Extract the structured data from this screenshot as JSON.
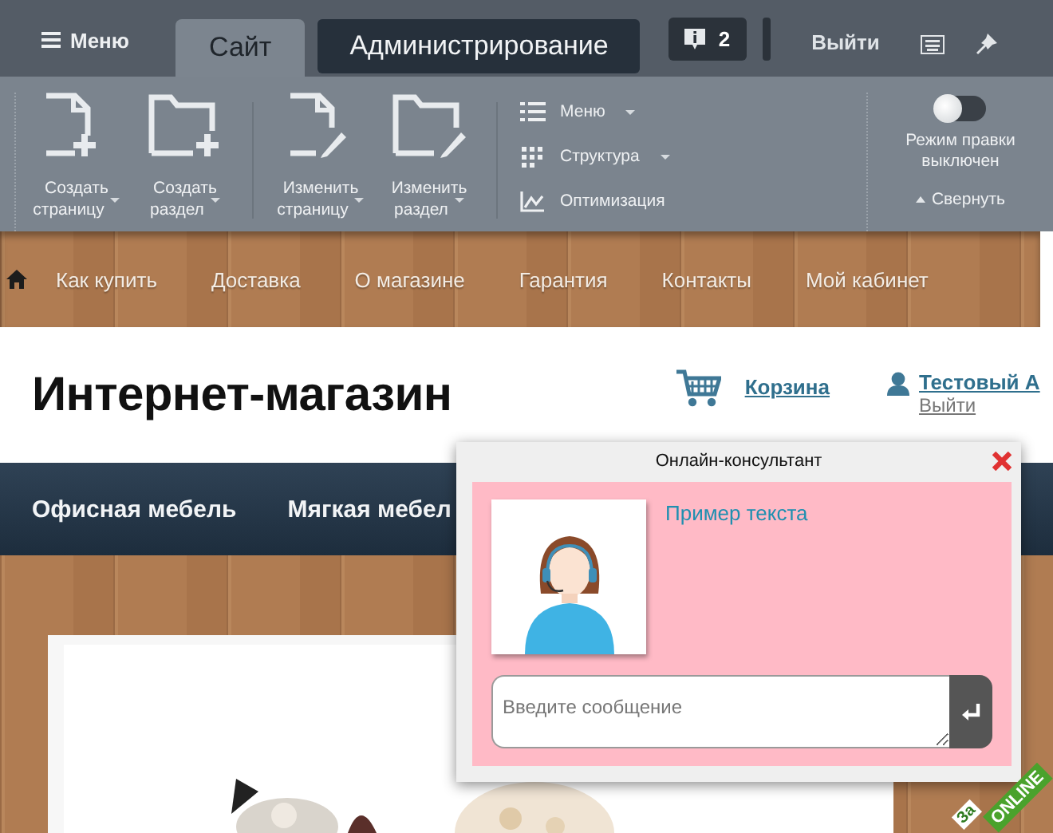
{
  "admin_bar": {
    "menu_button": "Меню",
    "tabs": [
      {
        "label": "Сайт",
        "selected": true
      },
      {
        "label": "Администрирование",
        "selected": false
      }
    ],
    "notifications": "2",
    "logout": "Выйти"
  },
  "toolbar": {
    "large_buttons": [
      {
        "kind": "page-add",
        "label": "Создать страницу",
        "dropdown": true
      },
      {
        "kind": "folder-add",
        "label": "Создать раздел",
        "dropdown": true
      },
      {
        "kind": "page-edit",
        "label": "Изменить страницу",
        "dropdown": true
      },
      {
        "kind": "folder-edit",
        "label": "Изменить раздел",
        "dropdown": true
      }
    ],
    "small_buttons": [
      {
        "kind": "list",
        "label": "Меню",
        "dropdown": true
      },
      {
        "kind": "grid",
        "label": "Структура",
        "dropdown": true
      },
      {
        "kind": "chart",
        "label": "Оптимизация",
        "dropdown": false
      }
    ],
    "edit_mode": {
      "label": "Режим правки выключен",
      "on": false
    },
    "collapse": "Свернуть"
  },
  "site_nav": [
    "Как купить",
    "Доставка",
    "О магазине",
    "Гарантия",
    "Контакты",
    "Мой кабинет"
  ],
  "site_header": {
    "title": "Интернет-магазин",
    "cart": "Корзина",
    "user": "Тестовый А",
    "logout": "Выйти"
  },
  "catalog_nav": [
    "Офисная мебель",
    "Мягкая мебел"
  ],
  "chat": {
    "title": "Онлайн-консультант",
    "message": "Пример текста",
    "input": {
      "placeholder": "Введите сообщение"
    }
  },
  "online_badge": {
    "caption": "За",
    "label": "ONLINE"
  }
}
